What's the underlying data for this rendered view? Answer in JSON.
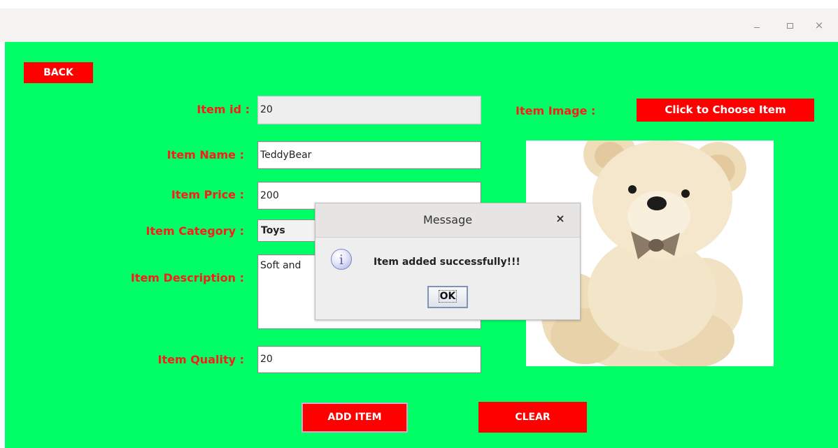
{
  "window": {
    "minimize_label": "–",
    "maximize_label": "□",
    "close_label": "×"
  },
  "form": {
    "back_label": "BACK",
    "item_id_label": "Item id :",
    "item_id_value": "20",
    "item_name_label": "Item Name :",
    "item_name_value": "TeddyBear",
    "item_price_label": "Item Price :",
    "item_price_value": "200",
    "item_category_label": "Item Category :",
    "item_category_value": "Toys",
    "item_description_label": "Item Description :",
    "item_description_value": "Soft and",
    "item_quality_label": "Item Quality :",
    "item_quality_value": "20",
    "item_image_label": "Item Image :",
    "choose_image_label": "Click to Choose Item",
    "add_item_label": "ADD ITEM",
    "clear_label": "CLEAR"
  },
  "dialog": {
    "title": "Message",
    "close_label": "×",
    "icon": "info-icon",
    "message": "Item added successfully!!!",
    "ok_label": "OK"
  },
  "colors": {
    "background": "#00ff66",
    "button": "#ff0000",
    "label": "#ff1a1a"
  }
}
